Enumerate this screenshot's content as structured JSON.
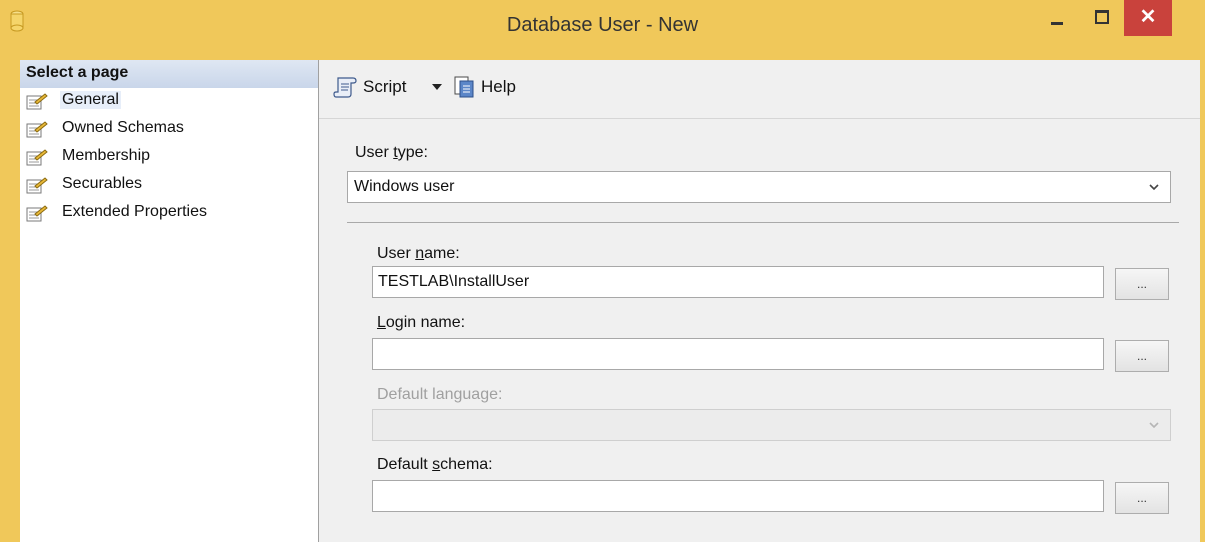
{
  "window": {
    "title": "Database User - New",
    "close_glyph": "✕"
  },
  "sidebar": {
    "title": "Select a page",
    "items": [
      {
        "label": "General",
        "selected": true
      },
      {
        "label": "Owned Schemas"
      },
      {
        "label": "Membership"
      },
      {
        "label": "Securables"
      },
      {
        "label": "Extended Properties"
      }
    ]
  },
  "toolbar": {
    "script_label": "Script",
    "help_label": "Help"
  },
  "form": {
    "user_type": {
      "label_pre": "User ",
      "label_ul": "t",
      "label_post": "ype:",
      "value": "Windows user"
    },
    "user_name": {
      "label_pre": "User ",
      "label_ul": "n",
      "label_post": "ame:",
      "value": "TESTLAB\\InstallUser"
    },
    "login_name": {
      "label_pre": "",
      "label_ul": "L",
      "label_post": "ogin name:",
      "value": ""
    },
    "default_language": {
      "label": "Default language:",
      "value": "",
      "disabled": true
    },
    "default_schema": {
      "label_pre": "Default ",
      "label_ul": "s",
      "label_post": "chema:",
      "value": ""
    },
    "browse_label": "..."
  },
  "colors": {
    "title_bar": "#f0c85a",
    "close_button": "#c9423c",
    "sidebar_header": "#c9d6ea"
  }
}
